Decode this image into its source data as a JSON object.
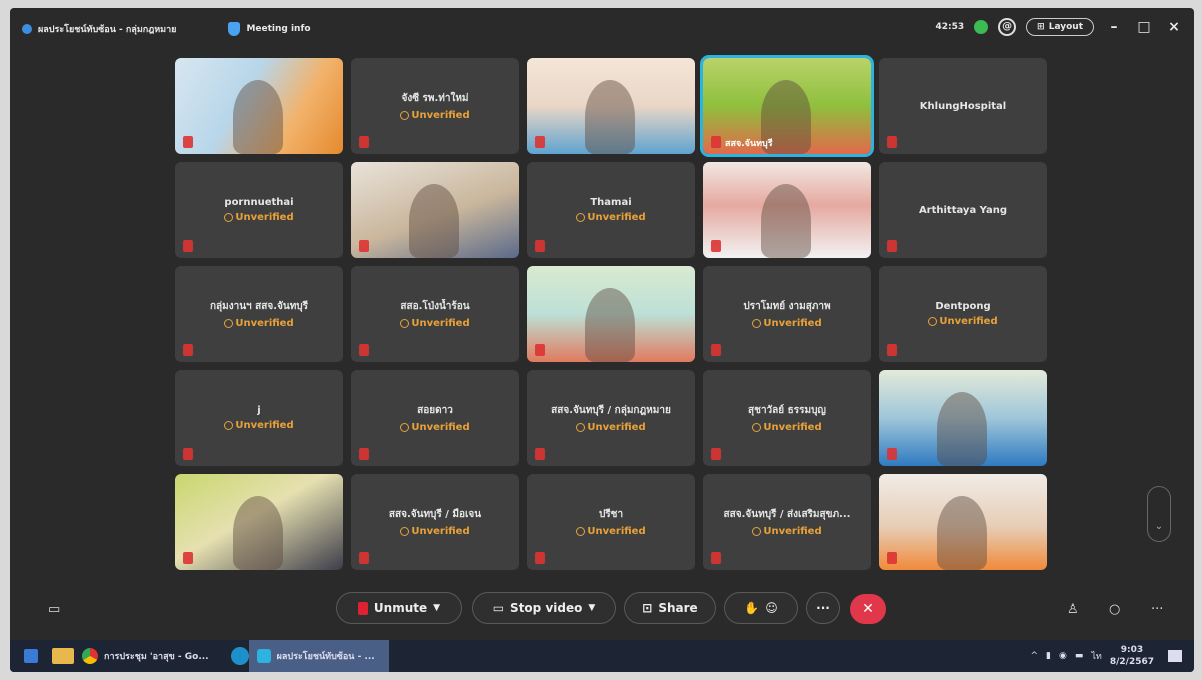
{
  "topbar": {
    "app_title": "ผลประโยชน์ทับซ้อน - กลุ่มกฎหมาย",
    "meeting_info": "Meeting info",
    "timer": "42:53",
    "layout_label": "Layout",
    "window_controls": [
      "–",
      "□",
      "×"
    ]
  },
  "participants": [
    {
      "name": "",
      "video": true,
      "video_class": "v1"
    },
    {
      "name": "จังซี รพ.ท่าใหม่",
      "status": "Unverified"
    },
    {
      "name": "",
      "video": true,
      "video_class": "v3"
    },
    {
      "name": "",
      "video": true,
      "video_class": "v4",
      "label": "สสจ.จันทบุรี",
      "active": true
    },
    {
      "name": "KhlungHospital"
    },
    {
      "name": "pornnuethai",
      "status": "Unverified"
    },
    {
      "name": "",
      "video": true,
      "video_class": "v7"
    },
    {
      "name": "Thamai",
      "status": "Unverified"
    },
    {
      "name": "",
      "video": true,
      "video_class": "v9"
    },
    {
      "name": "Arthittaya Yang"
    },
    {
      "name": "กลุ่มงานฯ สสจ.จันทบุรี",
      "status": "Unverified"
    },
    {
      "name": "สสอ.โป่งน้ำร้อน",
      "status": "Unverified"
    },
    {
      "name": "",
      "video": true,
      "video_class": "v13"
    },
    {
      "name": "ปราโมทย์ งามสุภาพ",
      "status": "Unverified"
    },
    {
      "name": "Dentpong",
      "status": "Unverified"
    },
    {
      "name": "j",
      "status": "Unverified"
    },
    {
      "name": "สอยดาว",
      "status": "Unverified"
    },
    {
      "name": "สสจ.จันทบุรี / กลุ่มกฎหมาย",
      "status": "Unverified"
    },
    {
      "name": "สุชาวัลย์ ธรรมบุญ",
      "status": "Unverified"
    },
    {
      "name": "",
      "video": true,
      "video_class": "v20"
    },
    {
      "name": "",
      "video": true,
      "video_class": "v21"
    },
    {
      "name": "สสจ.จันทบุรี / มือเจน",
      "status": "Unverified"
    },
    {
      "name": "ปรีชา",
      "status": "Unverified"
    },
    {
      "name": "สสจ.จันทบุรี / ส่งเสริมสุขภ...",
      "status": "Unverified"
    },
    {
      "name": "",
      "video": true,
      "video_class": "v25"
    }
  ],
  "controls": {
    "unmute": "Unmute",
    "stop_video": "Stop video",
    "share": "Share",
    "more": "···",
    "end": "✕"
  },
  "taskbar": {
    "task1": "การประชุม 'อาสุข - Go...",
    "task2": "ผลประโยชน์ทับซ้อน - ...",
    "time": "9:03",
    "date": "8/2/2567"
  },
  "colors": {
    "unverified": "#e8a23a",
    "active_border": "#2db3e0",
    "end_call": "#e0384a"
  }
}
